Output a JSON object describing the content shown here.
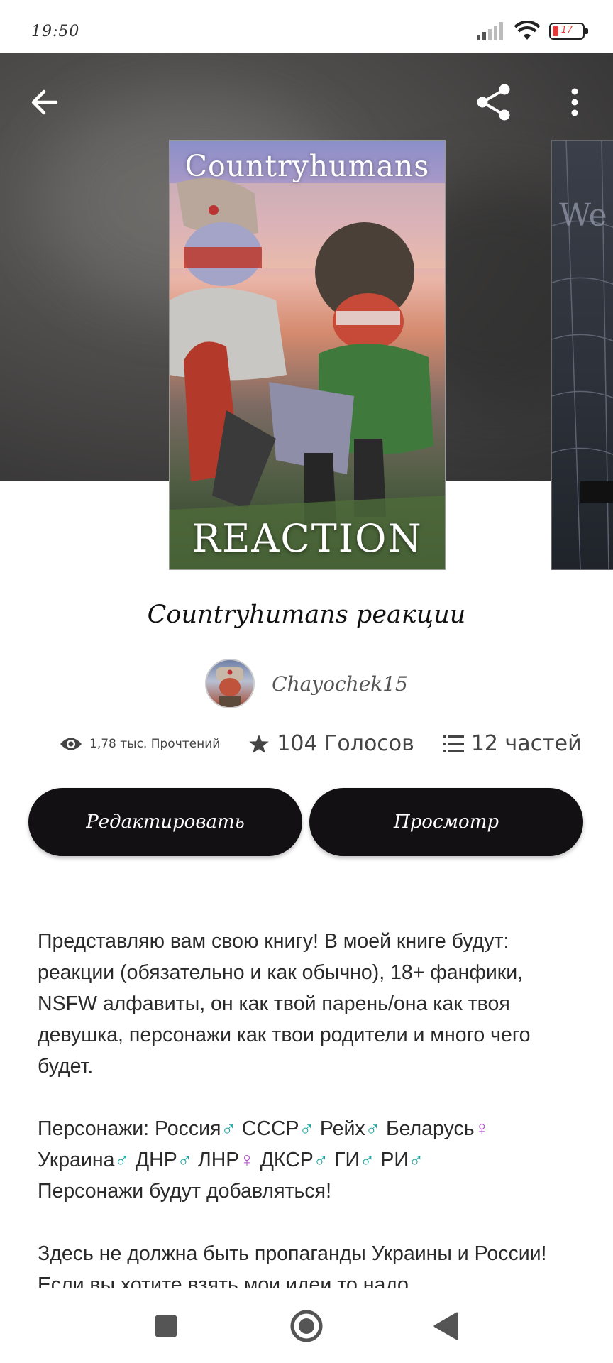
{
  "status_bar": {
    "time": "19:50",
    "battery_level": "17"
  },
  "book": {
    "cover_title": "Countryhumans",
    "cover_subtitle": "REACTION",
    "title": "Countryhumans реакции",
    "author": "Chayochek15"
  },
  "stats": {
    "reads": "1,78 тыс. Прочтений",
    "votes": "104 Голосов",
    "parts": "12 частей"
  },
  "buttons": {
    "edit": "Редактировать",
    "view": "Просмотр"
  },
  "description": {
    "p1": "Представляю вам свою книгу! В моей книге будут: реакции (обязательно и как обычно), 18+ фанфики, NSFW алфавиты, он как твой парень/она как твоя девушка, персонажи как твои родители и много чего будет.",
    "characters_label": "Персонажи: ",
    "characters": [
      {
        "name": "Россия",
        "gender": "male"
      },
      {
        "name": "СССР",
        "gender": "male"
      },
      {
        "name": "Рейх",
        "gender": "male"
      },
      {
        "name": "Беларусь",
        "gender": "female"
      },
      {
        "name": "Украина",
        "gender": "male"
      },
      {
        "name": "ДНР",
        "gender": "male"
      },
      {
        "name": "ЛНР",
        "gender": "female"
      },
      {
        "name": "ДКСР",
        "gender": "male"
      },
      {
        "name": "ГИ",
        "gender": "male"
      },
      {
        "name": "РИ",
        "gender": "male"
      }
    ],
    "male_symbol": "♂",
    "female_symbol": "♀",
    "p2_end": "Персонажи будут добавляться!",
    "p3": "Здесь не должна быть пропаганды Украины и России! Если вы хотите взять мои идеи то надо"
  },
  "colors": {
    "button_bg": "#121012",
    "male": "#1aa6a0",
    "female": "#b04fc8"
  },
  "icons": {
    "back": "arrow-left-icon",
    "share": "share-icon",
    "more": "more-vertical-icon",
    "views": "eye-icon",
    "votes": "star-icon",
    "parts": "list-icon"
  }
}
